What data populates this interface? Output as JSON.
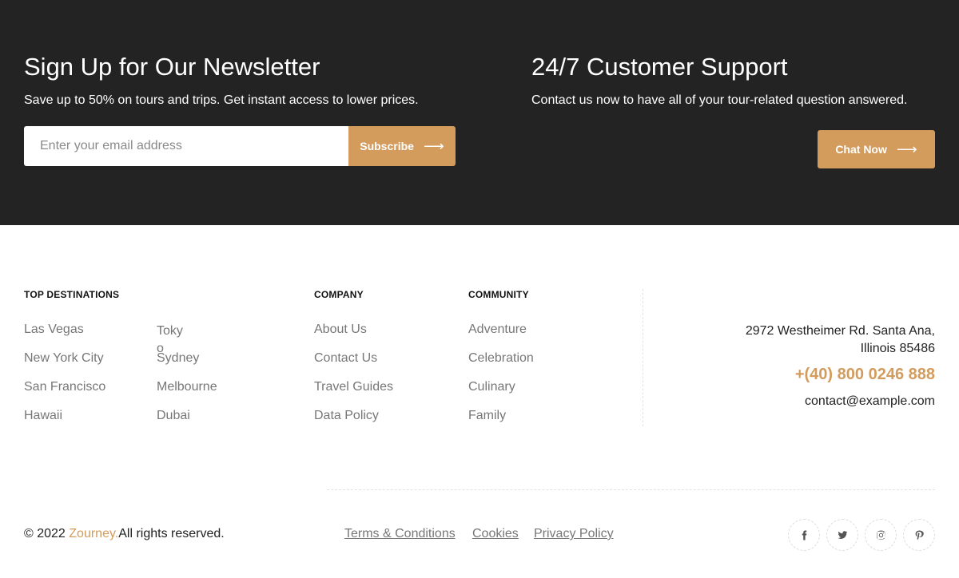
{
  "newsletter": {
    "title": "Sign Up for Our Newsletter",
    "subtitle": "Save up to 50% on tours and trips. Get instant access to lower prices.",
    "email_placeholder": "Enter your email address",
    "subscribe_label": "Subscribe"
  },
  "support": {
    "title": "24/7 Customer Support",
    "subtitle": "Contact us now to have all of your tour-related question answered.",
    "chat_label": "Chat Now"
  },
  "destinations": {
    "heading": "TOP DESTINATIONS",
    "col1": [
      "Las Vegas",
      "New York City",
      "San Francisco",
      "Hawaii"
    ],
    "col2": [
      "Tokyo",
      "Sydney",
      "Melbourne",
      "Dubai"
    ]
  },
  "company": {
    "heading": "COMPANY",
    "items": [
      "About Us",
      "Contact Us",
      "Travel Guides",
      "Data Policy"
    ]
  },
  "community": {
    "heading": "COMMUNITY",
    "items": [
      "Adventure",
      "Celebration",
      "Culinary",
      "Family"
    ]
  },
  "contact": {
    "address": "2972 Westheimer Rd. Santa Ana, Illinois 85486",
    "phone": "+(40) 800 0246 888",
    "email": "contact@example.com"
  },
  "bottom": {
    "copyright_prefix": "© 2022 ",
    "brand": "Zourney.",
    "copyright_suffix": "All rights reserved.",
    "legal": [
      "Terms & Conditions",
      "Cookies",
      "Privacy Policy"
    ],
    "social_icons": [
      "facebook-icon",
      "twitter-icon",
      "instagram-icon",
      "pinterest-icon"
    ]
  },
  "colors": {
    "accent": "#d39b5c",
    "dark_band": "#232323"
  }
}
